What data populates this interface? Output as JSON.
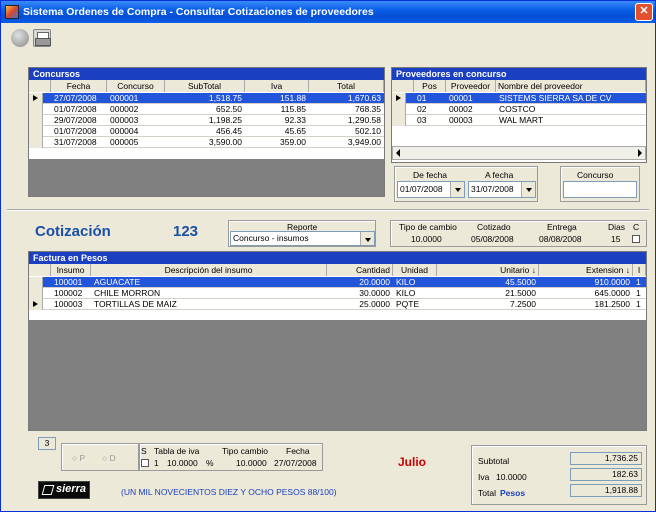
{
  "window": {
    "title": "Sistema Ordenes de Compra - Consultar Cotizaciones de proveedores",
    "close_glyph": "✕"
  },
  "toolbar": {
    "icons": [
      "circle-icon",
      "printer-icon"
    ]
  },
  "concursos": {
    "title": "Concursos",
    "columns": [
      "Fecha",
      "Concurso",
      "SubTotal",
      "Iva",
      "Total"
    ],
    "rows": [
      {
        "fecha": "27/07/2008",
        "concurso": "000001",
        "subtotal": "1,518.75",
        "iva": "151.88",
        "total": "1,670.63",
        "selected": true
      },
      {
        "fecha": "01/07/2008",
        "concurso": "000002",
        "subtotal": "652.50",
        "iva": "115.85",
        "total": "768.35"
      },
      {
        "fecha": "29/07/2008",
        "concurso": "000003",
        "subtotal": "1,198.25",
        "iva": "92.33",
        "total": "1,290.58"
      },
      {
        "fecha": "01/07/2008",
        "concurso": "000004",
        "subtotal": "456.45",
        "iva": "45.65",
        "total": "502.10"
      },
      {
        "fecha": "31/07/2008",
        "concurso": "000005",
        "subtotal": "3,590.00",
        "iva": "359.00",
        "total": "3,949.00"
      }
    ]
  },
  "proveedores": {
    "title": "Proveedores en concurso",
    "columns": [
      "Pos",
      "Proveedor",
      "Nombre del proveedor"
    ],
    "rows": [
      {
        "pos": "01",
        "proveedor": "00001",
        "nombre": "SISTEMS SIERRA SA DE CV",
        "selected": true
      },
      {
        "pos": "02",
        "proveedor": "00002",
        "nombre": "COSTCO"
      },
      {
        "pos": "03",
        "proveedor": "00003",
        "nombre": "WAL MART"
      }
    ]
  },
  "filters": {
    "de_fecha_label": "De fecha",
    "de_fecha_value": "01/07/2008",
    "a_fecha_label": "A fecha",
    "a_fecha_value": "31/07/2008",
    "concurso_label": "Concurso",
    "concurso_value": ""
  },
  "cotizacion": {
    "label": "Cotización",
    "number": "123",
    "reporte_label": "Reporte",
    "reporte_value": "Concurso - insumos",
    "tipo_cambio_label": "Tipo de cambio",
    "tipo_cambio_value": "10.0000",
    "cotizado_label": "Cotizado",
    "cotizado_value": "05/08/2008",
    "entrega_label": "Entrega",
    "entrega_value": "08/08/2008",
    "dias_label": "Dias",
    "dias_value": "15",
    "c_label": "C"
  },
  "factura": {
    "title": "Factura en Pesos",
    "columns": [
      "Insumo",
      "Descripción del insumo",
      "Cantidad",
      "Unidad",
      "Unitario ↓",
      "Extension ↓",
      "I"
    ],
    "rows": [
      {
        "insumo": "100001",
        "descripcion": "AGUACATE",
        "cantidad": "20.0000",
        "unidad": "KILO",
        "unitario": "45.5000",
        "extension": "910.0000",
        "i": "1",
        "selected": true
      },
      {
        "insumo": "100002",
        "descripcion": "CHILE MORRON",
        "cantidad": "30.0000",
        "unidad": "KILO",
        "unitario": "21.5000",
        "extension": "645.0000",
        "i": "1"
      },
      {
        "insumo": "100003",
        "descripcion": "TORTILLAS DE MAIZ",
        "cantidad": "25.0000",
        "unidad": "PQTE",
        "unitario": "7.2500",
        "extension": "181.2500",
        "i": "1",
        "current": true
      }
    ]
  },
  "footer": {
    "count": "3",
    "radio_p": "P",
    "radio_d": "D",
    "s_label": "S",
    "tabla_iva_label": "Tabla de iva",
    "tabla_iva_num": "1",
    "tabla_iva_value": "10.0000",
    "percent": "%",
    "tipo_cambio_label": "Tipo cambio",
    "tipo_cambio_value": "10.0000",
    "fecha_label": "Fecha",
    "fecha_value": "27/07/2008",
    "month": "Julio",
    "monto_letra": "(UN MIL NOVECIENTOS DIEZ Y OCHO PESOS 88/100)",
    "logo_text": "sierra",
    "subtotal_label": "Subtotal",
    "subtotal_value": "1,736.25",
    "iva_label": "Iva",
    "iva_rate": "10.0000",
    "iva_value": "182.63",
    "total_label": "Total",
    "total_currency": "Pesos",
    "total_value": "1,918.88"
  },
  "colors": {
    "accent": "#1a3fc0",
    "selected": "#2255d9",
    "cotizacion_blue": "#1a4fa8",
    "month_red": "#cc0000"
  }
}
